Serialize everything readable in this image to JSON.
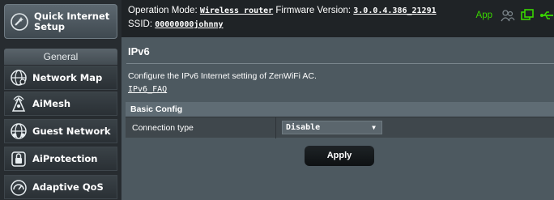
{
  "sidebar": {
    "quick_setup_label": "Quick Internet Setup",
    "general_label": "General",
    "items": [
      {
        "label": "Network Map",
        "icon": "network-map-icon"
      },
      {
        "label": "AiMesh",
        "icon": "aimesh-icon"
      },
      {
        "label": "Guest Network",
        "icon": "guest-network-icon"
      },
      {
        "label": "AiProtection",
        "icon": "lock-icon"
      },
      {
        "label": "Adaptive QoS",
        "icon": "qos-gauge-icon"
      }
    ]
  },
  "header": {
    "op_mode_label": "Operation Mode:",
    "op_mode_value": "Wireless router",
    "fw_label": "Firmware Version:",
    "fw_value": "3.0.0.4.386_21291",
    "ssid_label": "SSID:",
    "ssid_value": "00000000johnny",
    "app_label": "App",
    "icons": [
      "users-icon",
      "network-status-icon",
      "usb-icon"
    ],
    "accent_color": "#39d600"
  },
  "main": {
    "title": "IPv6",
    "description": "Configure the IPv6 Internet setting of ZenWiFi AC.",
    "faq_link": "IPv6_FAQ",
    "section_title": "Basic Config",
    "connection_type_label": "Connection type",
    "connection_type_value": "Disable",
    "apply_label": "Apply"
  }
}
